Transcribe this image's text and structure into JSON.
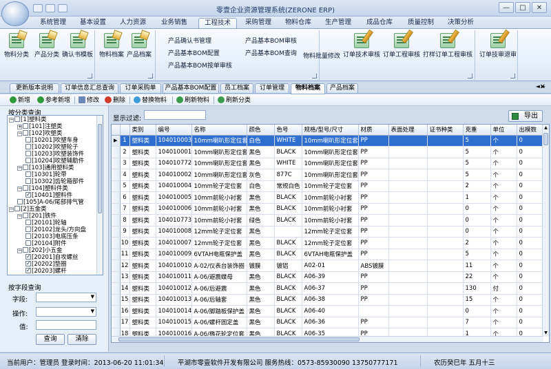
{
  "window": {
    "title": "零壹企业资源管理系统(ZERONE ERP)",
    "min": "—",
    "max": "□",
    "close": "✕"
  },
  "menu": {
    "items": [
      "系统管理",
      "基本设置",
      "人力资源",
      "业务销售",
      "工程技术",
      "采购管理",
      "物料仓库",
      "生产管理",
      "成品仓库",
      "质量控制",
      "决策分析"
    ],
    "active_index": 4
  },
  "ribbon": {
    "g1": [
      "物料分类",
      "产品分类",
      "确认书模板"
    ],
    "g2": [
      "物料档案",
      "产品档案"
    ],
    "g3": [
      "产品确认书管理",
      "产品基本BOM配置",
      "产品基本BOM按单审核"
    ],
    "g4": [
      "产品基本BOM审核",
      "产品基本BOM查询"
    ],
    "g5": [
      "物料批量修改"
    ],
    "g6": [
      "订单技术审核",
      "订单工程审核",
      "打样订单工程审核"
    ],
    "g7": [
      "订单技审退审"
    ]
  },
  "doc_tabs": {
    "items": [
      "更新版本说明",
      "订单信息汇总查询",
      "订单采购单",
      "产品基本BOM配置",
      "员工档案",
      "订单管理",
      "物料档案",
      "产品档案"
    ],
    "active_index": 6
  },
  "toolbar": {
    "add": "新增",
    "ref_add": "参考新增",
    "edit": "修改",
    "delete": "删除",
    "replace": "替换物料",
    "refresh_mat": "刷新物料",
    "refresh_cat": "刷新分类"
  },
  "left": {
    "title": "按分类查询",
    "tree": [
      {
        "label": "[1]塑料类",
        "indent": 0,
        "pm": "−",
        "checked": false
      },
      {
        "label": "[101]注塑类",
        "indent": 1,
        "pm": "+",
        "checked": false
      },
      {
        "label": "[102]吹塑类",
        "indent": 1,
        "pm": "−",
        "checked": false
      },
      {
        "label": "[10201]吹塑车身",
        "indent": 2,
        "pm": "",
        "checked": false
      },
      {
        "label": "[10202]吹塑轮子",
        "indent": 2,
        "pm": "",
        "checked": false
      },
      {
        "label": "[10203]吹塑装饰件",
        "indent": 2,
        "pm": "",
        "checked": false
      },
      {
        "label": "[10204]吹塑辅助件",
        "indent": 2,
        "pm": "",
        "checked": false
      },
      {
        "label": "[103]通用塑料类",
        "indent": 1,
        "pm": "−",
        "checked": false
      },
      {
        "label": "[10301]轮带",
        "indent": 2,
        "pm": "",
        "checked": false
      },
      {
        "label": "[10302]齿轮箱部件",
        "indent": 2,
        "pm": "",
        "checked": false
      },
      {
        "label": "[104]塑料件类",
        "indent": 1,
        "pm": "−",
        "checked": false
      },
      {
        "label": "[10401]塑料件",
        "indent": 2,
        "pm": "",
        "checked": true
      },
      {
        "label": "[105]A-06/尾部排气管",
        "indent": 1,
        "pm": "",
        "checked": false
      },
      {
        "label": "[2]五金类",
        "indent": 0,
        "pm": "−",
        "checked": false
      },
      {
        "label": "[201]铁件",
        "indent": 1,
        "pm": "−",
        "checked": false
      },
      {
        "label": "[20101]轮轴",
        "indent": 2,
        "pm": "",
        "checked": false
      },
      {
        "label": "[20102]龙头/方向盘",
        "indent": 2,
        "pm": "",
        "checked": false
      },
      {
        "label": "[20103]电底压条",
        "indent": 2,
        "pm": "",
        "checked": false
      },
      {
        "label": "[20104]附件",
        "indent": 2,
        "pm": "",
        "checked": false
      },
      {
        "label": "[202]小五金",
        "indent": 1,
        "pm": "−",
        "checked": false
      },
      {
        "label": "[20201]自攻螺丝",
        "indent": 2,
        "pm": "",
        "checked": true
      },
      {
        "label": "[20202]垫圈",
        "indent": 2,
        "pm": "",
        "checked": true
      },
      {
        "label": "[20203]螺杆",
        "indent": 2,
        "pm": "",
        "checked": true
      }
    ],
    "field_query": "按字段查询",
    "field_label": "字段:",
    "op_label": "操作:",
    "value_label": "值:",
    "query_btn": "查询",
    "clear_btn": "清除"
  },
  "filter": {
    "label": "显示过滤:",
    "export": "导出"
  },
  "grid": {
    "columns": [
      "类别",
      "编号",
      "名称",
      "颜色",
      "色号",
      "规格/型号/尺寸",
      "材质",
      "表面处理",
      "证书种类",
      "克重",
      "单位",
      "出模数"
    ],
    "selected_index": 0,
    "rows": [
      {
        "n": "1",
        "c": [
          "塑料类",
          "104010003",
          "10mm喇叭形定位套",
          "白色",
          "WHITE",
          "10mm喇叭形定位套",
          "PP",
          "",
          "",
          "5",
          "个",
          "0"
        ]
      },
      {
        "n": "2",
        "c": [
          "塑料类",
          "104010001",
          "10mm喇叭形定位套",
          "黑色",
          "BLACK",
          "10mm喇叭形定位套",
          "PP",
          "",
          "",
          "5",
          "个",
          "0"
        ]
      },
      {
        "n": "3",
        "c": [
          "塑料类",
          "104010772",
          "10mm喇叭形定位套",
          "黑色",
          "WHITE",
          "10mm喇叭形定位套",
          "PP",
          "",
          "",
          "5",
          "个",
          "0"
        ]
      },
      {
        "n": "4",
        "c": [
          "塑料类",
          "104010002",
          "10mm喇叭形定位套",
          "灰色",
          "877C",
          "10mm喇叭形定位套",
          "PP",
          "",
          "",
          "5",
          "个",
          "0"
        ]
      },
      {
        "n": "5",
        "c": [
          "塑料类",
          "104010004",
          "10mm轮子定位套",
          "白色",
          "常规白色",
          "10mm轮子定位套",
          "PP",
          "",
          "",
          "2",
          "个",
          "0"
        ]
      },
      {
        "n": "6",
        "c": [
          "塑料类",
          "104010005",
          "10mm前轮小衬套",
          "黑色",
          "BLACK",
          "10mm前轮小衬套",
          "PP",
          "",
          "",
          "1",
          "个",
          "0"
        ]
      },
      {
        "n": "7",
        "c": [
          "塑料类",
          "104010006",
          "10mm前轮小衬套",
          "黑色",
          "BLACK",
          "10mm前轮小衬套",
          "PP",
          "",
          "",
          "0",
          "个",
          "0"
        ]
      },
      {
        "n": "8",
        "c": [
          "塑料类",
          "104010773",
          "10mm前轮小衬套",
          "绿色",
          "BLACK",
          "10mm前轮小衬套",
          "PP",
          "",
          "",
          "0",
          "个",
          "0"
        ]
      },
      {
        "n": "9",
        "c": [
          "塑料类",
          "104010008",
          "12mm轮子定位套",
          "黑色",
          "",
          "12mm轮子定位套",
          "PP",
          "",
          "",
          "0",
          "个",
          "0"
        ]
      },
      {
        "n": "10",
        "c": [
          "塑料类",
          "104010007",
          "12mm轮子定位套",
          "黑色",
          "BLACK",
          "12mm轮子定位套",
          "PP",
          "",
          "",
          "2",
          "个",
          "0"
        ]
      },
      {
        "n": "11",
        "c": [
          "塑料类",
          "104010009",
          "6VTAH电瓶保护盖",
          "黑色",
          "BLACK",
          "6VTAH电瓶保护盖",
          "PP",
          "",
          "",
          "5",
          "个",
          "0"
        ]
      },
      {
        "n": "12",
        "c": [
          "塑料类",
          "104010010",
          "A-02/仪表台装饰圈",
          "镀膜",
          "镀铝",
          "A02-01",
          "ABS镀膜",
          "",
          "",
          "11",
          "个",
          "0"
        ]
      },
      {
        "n": "13",
        "c": [
          "塑料类",
          "104010011",
          "A-06/避震蝶母",
          "黑色",
          "BLACK",
          "A06-39",
          "PP",
          "",
          "",
          "22",
          "个",
          "0"
        ]
      },
      {
        "n": "14",
        "c": [
          "塑料类",
          "104010012",
          "A-06/后避震",
          "黑色",
          "BLACK",
          "A06-37",
          "PP",
          "",
          "",
          "130",
          "付",
          "0"
        ]
      },
      {
        "n": "15",
        "c": [
          "塑料类",
          "104010013",
          "A-06/后轴套",
          "黑色",
          "BLACK",
          "A06-38",
          "PP",
          "",
          "",
          "15",
          "个",
          "0"
        ]
      },
      {
        "n": "16",
        "c": [
          "塑料类",
          "104010014",
          "A-06/脚踏板保护盖",
          "黑色",
          "BLACK",
          "A06-40",
          "",
          "",
          "",
          "0",
          "个",
          "0"
        ]
      },
      {
        "n": "17",
        "c": [
          "塑料类",
          "104010015",
          "A-06/螺杆固定盖",
          "黑色",
          "BLACK",
          "A06-36",
          "PP",
          "",
          "",
          "7",
          "个",
          "0"
        ]
      },
      {
        "n": "18",
        "c": [
          "塑料类",
          "104010016",
          "A-06/椭花轮定位套",
          "黑色",
          "BLACK",
          "A06-35",
          "PP",
          "",
          "",
          "1",
          "个",
          "0"
        ]
      }
    ]
  },
  "status": {
    "user": "当前用户：管理员 登录时间：2013-06-20 11:01:34",
    "company": "平湖市零壹软件开发有限公司 服务热线：0573-85930090 13750777171",
    "lunar": "农历癸巳年 五月十三"
  }
}
